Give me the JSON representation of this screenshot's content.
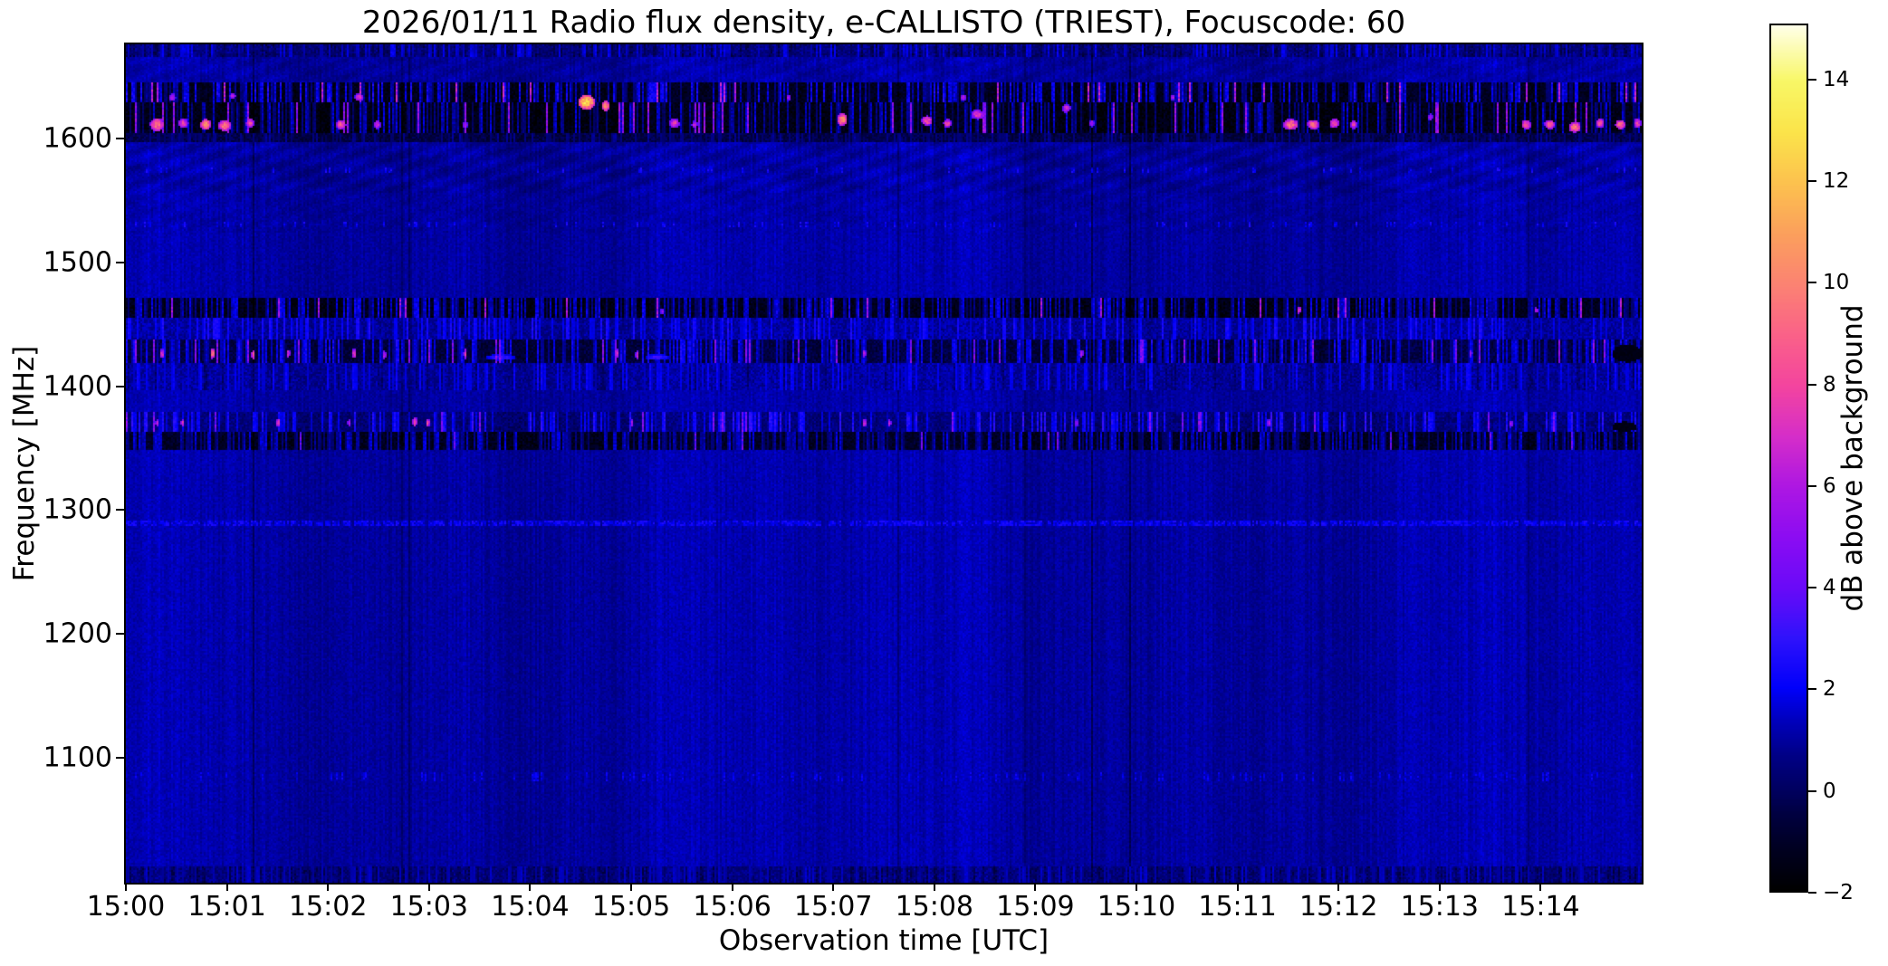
{
  "figure": {
    "title": "2026/01/11  Radio flux density, e-CALLISTO (TRIEST), Focuscode: 60"
  },
  "chart_data": {
    "type": "heatmap",
    "title": "2026/01/11  Radio flux density, e-CALLISTO (TRIEST), Focuscode: 60",
    "xlabel": "Observation time [UTC]",
    "ylabel": "Frequency [MHz]",
    "colorbar_label": "dB above background",
    "x_ticks": [
      "15:00",
      "15:01",
      "15:02",
      "15:03",
      "15:04",
      "15:05",
      "15:06",
      "15:07",
      "15:08",
      "15:09",
      "15:10",
      "15:11",
      "15:12",
      "15:13",
      "15:14"
    ],
    "x_tick_minutes": [
      0,
      1,
      2,
      3,
      4,
      5,
      6,
      7,
      8,
      9,
      10,
      11,
      12,
      13,
      14
    ],
    "x_range_minutes_after_1500utc": [
      0,
      15
    ],
    "y_ticks": [
      1600,
      1500,
      1400,
      1300,
      1200,
      1100
    ],
    "y_range_mhz": [
      999,
      1676
    ],
    "colorbar_ticks": [
      "14",
      "12",
      "10",
      "8",
      "6",
      "4",
      "2",
      "0",
      "−2"
    ],
    "colorbar_tick_values": [
      14,
      12,
      10,
      8,
      6,
      4,
      2,
      0,
      -2
    ],
    "value_range_db": [
      -2,
      15.1
    ],
    "background_level_db": 1.05,
    "colormap_stops": [
      [
        -2,
        "#000000"
      ],
      [
        -1.2,
        "#000020"
      ],
      [
        -0.5,
        "#000040"
      ],
      [
        0,
        "#000060"
      ],
      [
        0.7,
        "#000088"
      ],
      [
        1.4,
        "#0000c0"
      ],
      [
        2,
        "#0000fa"
      ],
      [
        3,
        "#3012fb"
      ],
      [
        4,
        "#6a0af8"
      ],
      [
        5,
        "#8c0cf2"
      ],
      [
        6,
        "#ae17e2"
      ],
      [
        7,
        "#d62ec8"
      ],
      [
        8,
        "#f4459e"
      ],
      [
        9,
        "#fa6288"
      ],
      [
        10,
        "#fb8372"
      ],
      [
        11,
        "#fba05c"
      ],
      [
        12,
        "#fcc24e"
      ],
      [
        13,
        "#fbe44a"
      ],
      [
        14,
        "#f8f766"
      ],
      [
        15.1,
        "#ffffe8"
      ]
    ],
    "interference_bands": [
      {
        "name": "top-edge-streaks",
        "f0": 1666,
        "f1": 1676,
        "base": 0.5,
        "dash_p": 0.25,
        "dash_v": 1.3,
        "neg_p": 0.3
      },
      {
        "name": "gnss-band-upper",
        "f0": 1629,
        "f1": 1645,
        "base": -1.3,
        "dash_p": 0.45,
        "dash_v": 3.1,
        "bright_p": 0.03,
        "bright_v": 6.0
      },
      {
        "name": "gnss-band-lower",
        "f0": 1604,
        "f1": 1629,
        "base": -1.5,
        "dash_p": 0.36,
        "dash_v": 2.7,
        "bright_p": 0.04,
        "bright_v": 5.0
      },
      {
        "name": "gnss-band-edge",
        "f0": 1597,
        "f1": 1604,
        "base": -0.4,
        "dash_p": 0.25,
        "dash_v": 1.1
      },
      {
        "name": "band-1460",
        "f0": 1455,
        "f1": 1471,
        "base": -1.4,
        "dash_p": 0.5,
        "dash_v": 2.9,
        "bright_p": 0.02,
        "bright_v": 5.5
      },
      {
        "name": "band-1447",
        "f0": 1438,
        "f1": 1455,
        "base": 0.9,
        "dash_p": 0.3,
        "dash_v": 1.4
      },
      {
        "name": "band-1428",
        "f0": 1418,
        "f1": 1438,
        "base": -0.6,
        "dash_p": 0.42,
        "dash_v": 2.5,
        "bright_p": 0.025,
        "bright_v": 4.5
      },
      {
        "name": "band-1408",
        "f0": 1396,
        "f1": 1418,
        "base": 0.9,
        "dash_p": 0.25,
        "dash_v": 1.1,
        "neg_p": 0.12
      },
      {
        "name": "band-1370",
        "f0": 1363,
        "f1": 1379,
        "base": 0.4,
        "dash_p": 0.33,
        "dash_v": 2.1,
        "bright_p": 0.025,
        "bright_v": 4.5
      },
      {
        "name": "band-1356",
        "f0": 1349,
        "f1": 1363,
        "base": -1.2,
        "dash_p": 0.5,
        "dash_v": 2.5,
        "bright_p": 0.012,
        "bright_v": 4.0
      },
      {
        "name": "bottom-edge",
        "f0": 999,
        "f1": 1012,
        "base": 0.5,
        "dash_p": 0.25,
        "dash_v": 0.9,
        "neg_p": 0.3
      }
    ],
    "faint_lines": [
      {
        "name": "dotted-1574",
        "f": 1574,
        "h": 4,
        "p": 0.1,
        "v": 2.0
      },
      {
        "name": "dotted-1531",
        "f": 1531,
        "h": 4,
        "p": 0.12,
        "v": 2.0
      },
      {
        "name": "faint-1289",
        "f": 1289,
        "h": 4,
        "p": 0.8,
        "v": 1.9
      },
      {
        "name": "dotted-1085",
        "f": 1085,
        "h": 7,
        "p": 0.15,
        "v": 1.7
      }
    ],
    "ripple_regions": [
      {
        "f0": 1645,
        "f1": 1668,
        "amp": 0.28
      },
      {
        "f0": 1556,
        "f1": 1597,
        "amp": 0.42
      },
      {
        "f0": 1524,
        "f1": 1556,
        "amp": 0.18
      }
    ],
    "bright_blobs_t_f_w_h_db": [
      [
        0.3,
        1612,
        0.14,
        11,
        9.5
      ],
      [
        0.56,
        1613,
        0.1,
        8,
        8
      ],
      [
        0.78,
        1612,
        0.11,
        9,
        10.5
      ],
      [
        0.97,
        1611,
        0.13,
        9,
        9.5
      ],
      [
        1.22,
        1613,
        0.08,
        8,
        8
      ],
      [
        0.45,
        1634,
        0.07,
        6,
        6.5
      ],
      [
        1.05,
        1635,
        0.06,
        5,
        6.5
      ],
      [
        2.12,
        1612,
        0.1,
        8,
        8.5
      ],
      [
        2.3,
        1634,
        0.09,
        6,
        7
      ],
      [
        2.48,
        1612,
        0.07,
        7,
        7
      ],
      [
        3.35,
        1612,
        0.05,
        6,
        6
      ],
      [
        4.55,
        1630,
        0.17,
        12,
        12.5
      ],
      [
        4.74,
        1627,
        0.09,
        9,
        10
      ],
      [
        5.42,
        1613,
        0.1,
        8,
        7.5
      ],
      [
        5.62,
        1612,
        0.06,
        6,
        6.5
      ],
      [
        6.55,
        1634,
        0.05,
        5,
        6
      ],
      [
        7.08,
        1616,
        0.1,
        10,
        10.5
      ],
      [
        7.92,
        1615,
        0.11,
        8,
        8.5
      ],
      [
        8.12,
        1613,
        0.08,
        7,
        8
      ],
      [
        8.42,
        1620,
        0.13,
        8,
        7.5
      ],
      [
        8.28,
        1634,
        0.06,
        5,
        6.5
      ],
      [
        9.3,
        1625,
        0.08,
        7,
        7
      ],
      [
        9.55,
        1613,
        0.05,
        6,
        6
      ],
      [
        10.35,
        1634,
        0.05,
        5,
        6
      ],
      [
        11.52,
        1612,
        0.15,
        9,
        9.5
      ],
      [
        11.74,
        1612,
        0.12,
        8,
        9
      ],
      [
        11.95,
        1613,
        0.1,
        8,
        8.5
      ],
      [
        12.14,
        1612,
        0.07,
        7,
        7.5
      ],
      [
        12.9,
        1618,
        0.05,
        6,
        6
      ],
      [
        13.85,
        1612,
        0.1,
        8,
        8.5
      ],
      [
        14.08,
        1612,
        0.1,
        8,
        9
      ],
      [
        14.33,
        1610,
        0.12,
        9,
        9.5
      ],
      [
        14.58,
        1613,
        0.08,
        8,
        8.5
      ],
      [
        14.78,
        1612,
        0.1,
        8,
        9.5
      ],
      [
        14.95,
        1613,
        0.07,
        8,
        8
      ],
      [
        5.3,
        1461,
        0.04,
        5,
        5.5
      ],
      [
        11.6,
        1462,
        0.04,
        6,
        8
      ],
      [
        13.95,
        1462,
        0.03,
        5,
        6.5
      ],
      [
        0.35,
        1427,
        0.035,
        8,
        8
      ],
      [
        0.85,
        1427,
        0.04,
        9,
        10
      ],
      [
        1.25,
        1426,
        0.035,
        8,
        8.5
      ],
      [
        1.6,
        1427,
        0.03,
        7,
        7.5
      ],
      [
        2.25,
        1427,
        0.04,
        8,
        8
      ],
      [
        2.55,
        1426,
        0.03,
        7,
        7
      ],
      [
        3.35,
        1427,
        0.035,
        8,
        7.5
      ],
      [
        4.85,
        1427,
        0.04,
        8,
        8
      ],
      [
        5.05,
        1426,
        0.03,
        7,
        7
      ],
      [
        7.3,
        1427,
        0.03,
        7,
        6.5
      ],
      [
        9.45,
        1427,
        0.03,
        7,
        7
      ],
      [
        13.3,
        1427,
        0.03,
        6,
        5.5
      ],
      [
        3.7,
        1424,
        0.3,
        5,
        3.2
      ],
      [
        5.25,
        1424,
        0.25,
        5,
        3.2
      ],
      [
        0.3,
        1371,
        0.03,
        6,
        7
      ],
      [
        0.55,
        1371,
        0.03,
        6,
        7.5
      ],
      [
        1.5,
        1371,
        0.04,
        7,
        8
      ],
      [
        2.2,
        1371,
        0.03,
        6,
        6.5
      ],
      [
        2.85,
        1372,
        0.05,
        8,
        8.5
      ],
      [
        2.98,
        1371,
        0.04,
        7,
        8
      ],
      [
        5.0,
        1371,
        0.03,
        6,
        6
      ],
      [
        7.3,
        1371,
        0.035,
        7,
        7.5
      ],
      [
        7.55,
        1371,
        0.03,
        6,
        7
      ],
      [
        9.4,
        1371,
        0.03,
        6,
        6
      ],
      [
        11.3,
        1371,
        0.03,
        6,
        6.5
      ],
      [
        13.7,
        1370,
        0.03,
        6,
        6
      ]
    ],
    "dark_patches_t_f_w_h": [
      [
        14.85,
        1427,
        0.3,
        14
      ],
      [
        14.82,
        1368,
        0.25,
        8
      ]
    ]
  }
}
